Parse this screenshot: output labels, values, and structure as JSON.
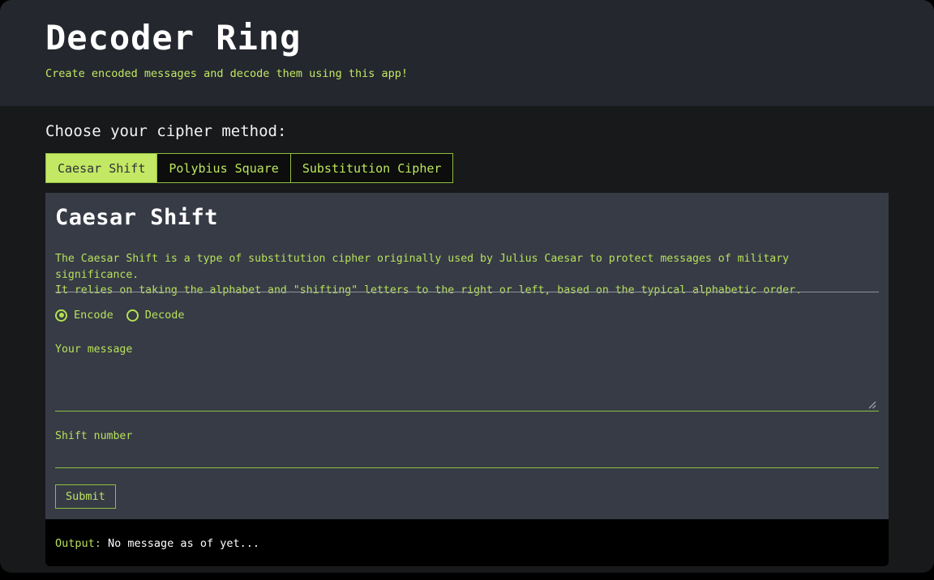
{
  "header": {
    "title": "Decoder Ring",
    "subtitle": "Create encoded messages and decode them using this app!"
  },
  "chooser": {
    "label": "Choose your cipher method:",
    "tabs": [
      {
        "label": "Caesar Shift",
        "active": true
      },
      {
        "label": "Polybius Square",
        "active": false
      },
      {
        "label": "Substitution Cipher",
        "active": false
      }
    ]
  },
  "card": {
    "heading": "Caesar Shift",
    "description": "The Caesar Shift is a type of substitution cipher originally used by Julius Caesar to protect messages of military significance.\nIt relies on taking the alphabet and \"shifting\" letters to the right or left, based on the typical alphabetic order.",
    "mode": {
      "options": [
        {
          "label": "Encode",
          "selected": true
        },
        {
          "label": "Decode",
          "selected": false
        }
      ]
    },
    "message_field": {
      "label": "Your message",
      "value": "",
      "placeholder": ""
    },
    "shift_field": {
      "label": "Shift number",
      "value": "",
      "placeholder": ""
    },
    "submit_label": "Submit"
  },
  "output": {
    "key": "Output: ",
    "value": "No message as of yet..."
  },
  "colors": {
    "accent_green": "#b8e05a",
    "active_tab_bg": "#c3e863",
    "header_bg": "#24272e",
    "card_bg": "#363b46",
    "page_bg": "#17191a",
    "output_bg": "#000000"
  }
}
